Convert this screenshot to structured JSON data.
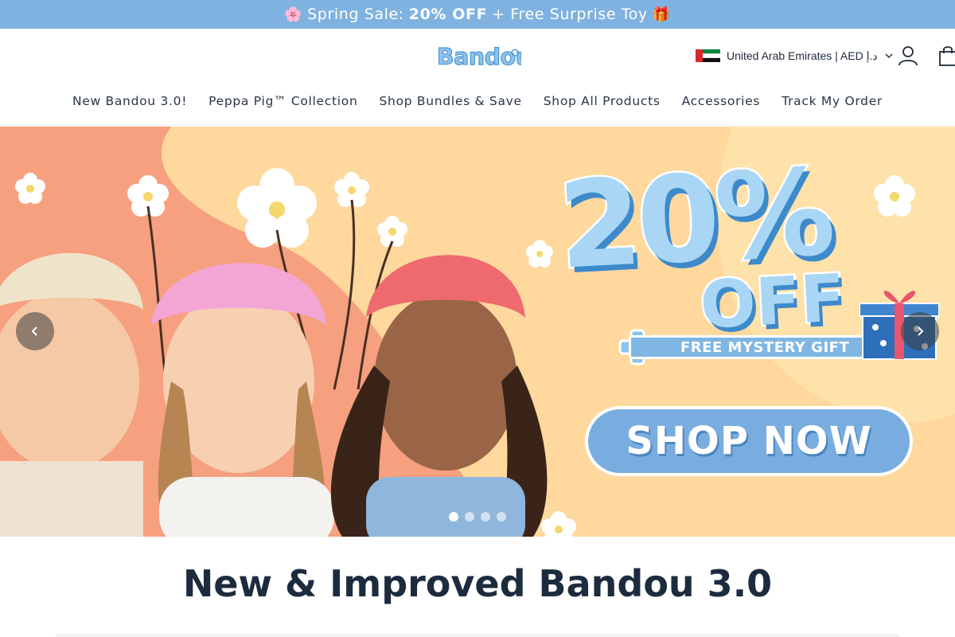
{
  "announcement": {
    "flower_emoji": "🌸",
    "lead": "Spring Sale:",
    "highlight": "20% OFF",
    "tail": "+ Free Surprise Toy",
    "gift_emoji": "🎁",
    "background": "#7fb2e0"
  },
  "header": {
    "logo_text": "Bandou",
    "locale_label": "United Arab Emirates | AED د.إ",
    "icons": [
      "user-icon",
      "shopping-bag-icon",
      "chevron-down-icon"
    ]
  },
  "nav": {
    "items": [
      "New Bandou 3.0!",
      "Peppa Pig™ Collection",
      "Shop Bundles & Save",
      "Shop All Products",
      "Accessories",
      "Track My Order"
    ]
  },
  "hero": {
    "discount": "20%",
    "off": "OFF",
    "gift_text": "FREE MYSTERY GIFT",
    "cta": "SHOP NOW",
    "slide_count": 4,
    "active_slide": 1,
    "colors": {
      "peach": "#f59e7e",
      "cream": "#ffd79a",
      "sky": "#79addf"
    }
  },
  "section": {
    "title": "New & Improved Bandou 3.0"
  }
}
